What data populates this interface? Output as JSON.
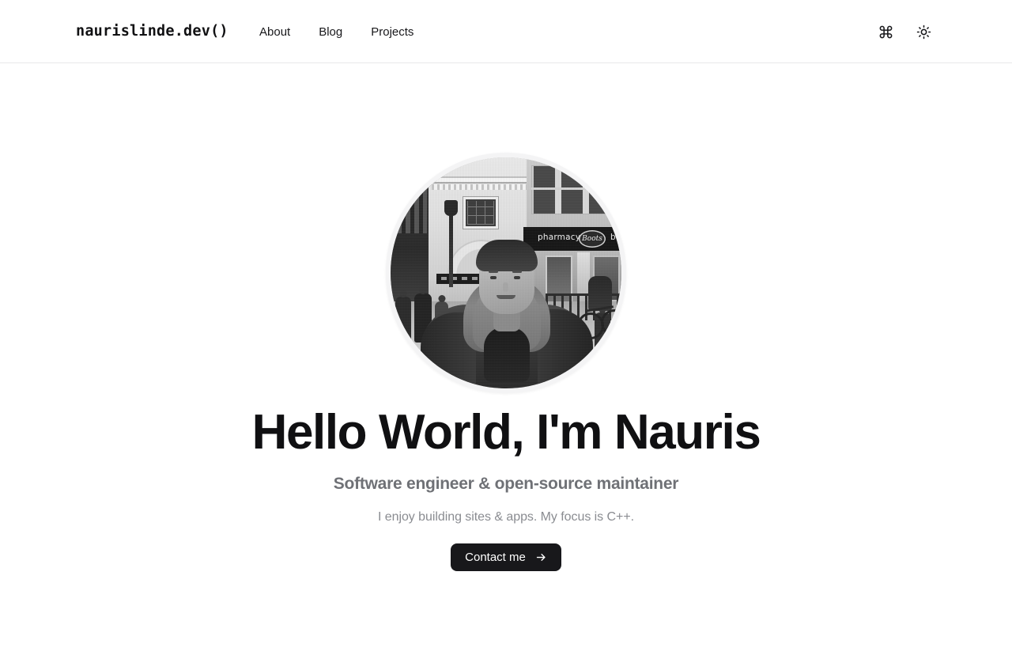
{
  "header": {
    "brand": "naurislinde.dev()",
    "nav": [
      {
        "label": "About"
      },
      {
        "label": "Blog"
      },
      {
        "label": "Projects"
      }
    ],
    "actions": {
      "command_palette": "command-icon",
      "theme_toggle": "sun-icon"
    }
  },
  "hero": {
    "avatar_alt": "Portrait of Nauris on a city street",
    "title": "Hello World, I'm Nauris",
    "subtitle": "Software engineer & open-source maintainer",
    "tagline": "I enjoy building sites & apps. My focus is C++.",
    "cta_label": "Contact me",
    "cta_arrow": "arrow-right-icon"
  },
  "photo": {
    "sign_pharmacy": "pharmacy",
    "sign_boots": "Boots",
    "sign_beauty": "beau"
  },
  "colors": {
    "text": "#101012",
    "muted": "#6f7176",
    "faint": "#8a8c91",
    "button_bg": "#18181b",
    "button_text": "#ffffff",
    "border": "#e8e8ea",
    "background": "#ffffff"
  }
}
